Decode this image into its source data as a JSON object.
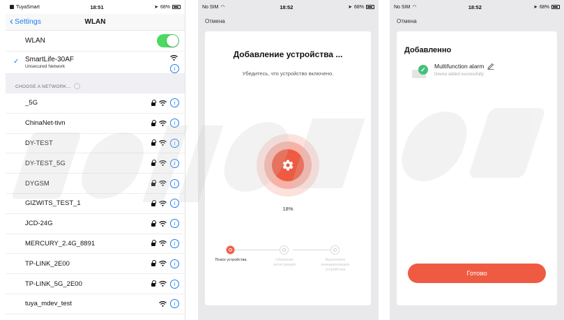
{
  "screen1": {
    "status": {
      "carrier": "TuyaSmart",
      "time": "18:51",
      "battery": "68%"
    },
    "nav": {
      "back_label": "Settings",
      "title": "WLAN"
    },
    "wlan_label": "WLAN",
    "connected": {
      "name": "SmartLife-30AF",
      "security": "Unsecured Network"
    },
    "section_header": "CHOOSE A NETWORK...",
    "networks": [
      {
        "name": "_5G",
        "locked": true
      },
      {
        "name": "ChinaNet-tivn",
        "locked": true
      },
      {
        "name": "DY-TEST",
        "locked": true
      },
      {
        "name": "DY-TEST_5G",
        "locked": true
      },
      {
        "name": "DYGSM",
        "locked": true
      },
      {
        "name": "GIZWITS_TEST_1",
        "locked": true
      },
      {
        "name": "JCD-24G",
        "locked": true
      },
      {
        "name": "MERCURY_2.4G_8891",
        "locked": true
      },
      {
        "name": "TP-LINK_2E00",
        "locked": true
      },
      {
        "name": "TP-LINK_5G_2E00",
        "locked": true
      },
      {
        "name": "tuya_mdev_test",
        "locked": false
      }
    ]
  },
  "screen2": {
    "status": {
      "carrier": "No SIM",
      "time": "18:52",
      "battery": "68%"
    },
    "cancel": "Отмена",
    "title": "Добавление устройства ...",
    "subtitle": "Убедитесь, что устройство включено.",
    "progress_text": "18%",
    "progress_fraction": 0.18,
    "steps": [
      {
        "label": "Поиск устройства",
        "active": true
      },
      {
        "label": "Облачная регистрация",
        "active": false
      },
      {
        "label": "Выполните инициализацию устройства",
        "active": false
      }
    ]
  },
  "screen3": {
    "status": {
      "carrier": "No SIM",
      "time": "18:52",
      "battery": "68%"
    },
    "cancel": "Отмена",
    "title": "Добавленно",
    "device_name": "Multifunction alarm",
    "device_status": "Device added successfully",
    "done_button": "Готово"
  },
  "colors": {
    "ios_blue": "#1a7cf2",
    "toggle_green": "#4cd964",
    "accent_orange": "#ee5b42",
    "success_green": "#45c07a"
  }
}
